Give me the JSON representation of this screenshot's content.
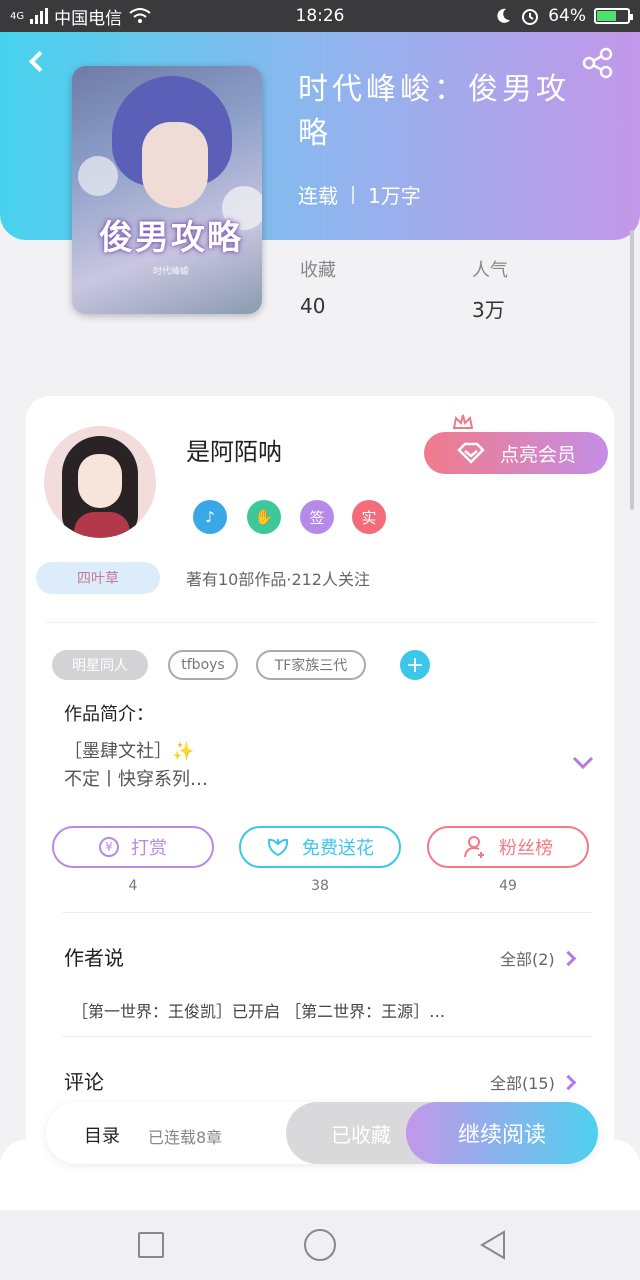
{
  "status_bar": {
    "network": "4G",
    "carrier": "中国电信",
    "time": "18:26",
    "battery": "64%",
    "battery_level": 0.64
  },
  "header": {
    "back_icon": "chevron-left-icon",
    "share_icon": "share-icon"
  },
  "book": {
    "title": "时代峰峻：俊男攻略",
    "status": "连载",
    "word_count": "1万字",
    "cover_title": "俊男攻略",
    "cover_series": "时代峰峻",
    "stats": [
      {
        "label": "收藏",
        "value": "40"
      },
      {
        "label": "人气",
        "value": "3万"
      }
    ]
  },
  "author": {
    "name": "是阿陌呐",
    "badge": "四叶草",
    "vip_button": "点亮会员",
    "honors": [
      {
        "icon": "music-note-icon",
        "color": "#3aa7e6"
      },
      {
        "icon": "handshake-icon",
        "color": "#3cc89a"
      },
      {
        "icon": "sign-icon",
        "text": "签",
        "color": "#b58ae8"
      },
      {
        "icon": "real-name-icon",
        "text": "实",
        "color": "#f26c7a"
      }
    ],
    "stats_text": "著有10部作品·212人关注"
  },
  "tags": [
    "明星同人",
    "tfboys",
    "TF家族三代"
  ],
  "intro": {
    "label": "作品简介：",
    "line1": "［墨肆文社］✨",
    "line2": "不定丨快穿系列…"
  },
  "actions": [
    {
      "label": "打赏",
      "count": "4",
      "icon": "yen-icon",
      "color": "#b58ae8"
    },
    {
      "label": "免费送花",
      "count": "38",
      "icon": "flower-icon",
      "color": "#3cc6ea"
    },
    {
      "label": "粉丝榜",
      "count": "49",
      "icon": "fans-icon",
      "color": "#f27a86"
    }
  ],
  "author_says": {
    "title": "作者说",
    "more": "全部(2)",
    "text": "［第一世界：王俊凯］已开启 ［第二世界：王源］…"
  },
  "comments": {
    "title": "评论",
    "more": "全部(15)"
  },
  "bottom_bar": {
    "toc_label": "目录",
    "chapter_info": "已连载8章",
    "collected_label": "已收藏",
    "read_label": "继续阅读"
  }
}
